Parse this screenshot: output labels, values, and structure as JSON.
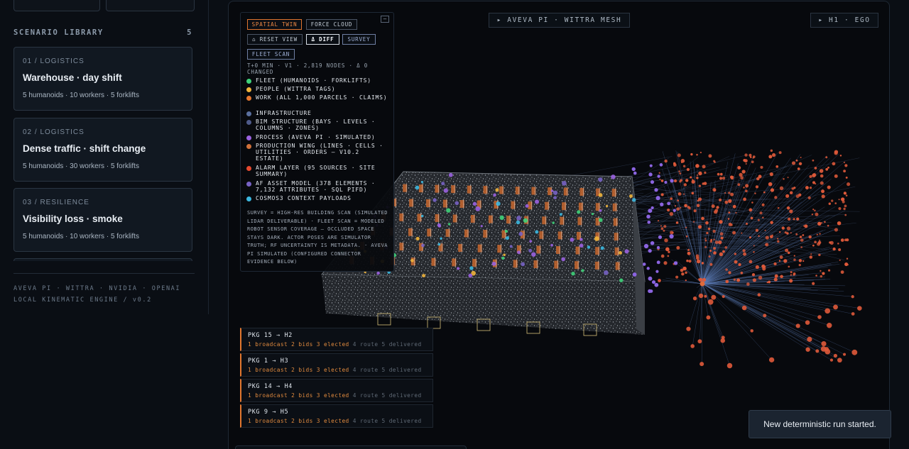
{
  "sidebar": {
    "library_title": "SCENARIO LIBRARY",
    "library_count": "5",
    "scenarios": [
      {
        "category": "01 / LOGISTICS",
        "title": "Warehouse · day shift",
        "meta": "5 humanoids · 10 workers · 5 forklifts"
      },
      {
        "category": "02 / LOGISTICS",
        "title": "Dense traffic · shift change",
        "meta": "5 humanoids · 30 workers · 5 forklifts"
      },
      {
        "category": "03 / RESILIENCE",
        "title": "Visibility loss · smoke",
        "meta": "5 humanoids · 10 workers · 5 forklifts"
      }
    ],
    "footer_line1": "AVEVA PI · WITTRA · NVIDIA · OPENAI",
    "footer_line2": "LOCAL KINEMATIC ENGINE / v0.2"
  },
  "viewport": {
    "center_chip": "▸ AVEVA PI · WITTRA MESH",
    "right_chip": "▸ H1 · EGO"
  },
  "panel": {
    "buttons": {
      "spatial_twin": "SPATIAL TWIN",
      "force_cloud": "FORCE CLOUD",
      "reset_view": "⌂ RESET VIEW",
      "diff": "Δ DIFF",
      "survey": "SURVEY",
      "fleet_scan": "FLEET SCAN",
      "collapse": "–"
    },
    "status": "T+0 MIN · V1 · 2,819 NODES · Δ 0 CHANGED",
    "legend": [
      {
        "label": "FLEET (HUMANOIDS · FORKLIFTS)",
        "color": "#3fd27a"
      },
      {
        "label": "PEOPLE (WITTRA TAGS)",
        "color": "#f0b43c"
      },
      {
        "label": "WORK (ALL 1,000 PARCELS · CLAIMS)",
        "color": "#e6772f"
      },
      {
        "label": "INFRASTRUCTURE",
        "color": "#5a6f9e"
      },
      {
        "label": "BIM STRUCTURE (BAYS · LEVELS · COLUMNS · ZONES)",
        "color": "#4e5a8a"
      },
      {
        "label": "PROCESS (AVEVA PI · SIMULATED)",
        "color": "#9a62e0"
      },
      {
        "label": "PRODUCTION WING (LINES · CELLS · UTILITIES · ORDERS — V10.2 ESTATE)",
        "color": "#d0713a"
      },
      {
        "label": "ALARM LAYER (95 SOURCES · SITE SUMMARY)",
        "color": "#e5492f"
      },
      {
        "label": "AF ASSET MODEL (378 ELEMENTS · 7,132 ATTRIBUTES · SQL PIFD)",
        "color": "#7762c4"
      },
      {
        "label": "COSMOS3 CONTEXT PAYLOADS",
        "color": "#3cb8e0"
      }
    ],
    "footnote": "SURVEY = HIGH-RES BUILDING SCAN (SIMULATED LIDAR DELIVERABLE) · FLEET SCAN = MODELED ROBOT SENSOR COVERAGE — OCCLUDED SPACE STAYS DARK. ACTOR POSES ARE SIMULATOR TRUTH; RF UNCERTAINTY IS METADATA. · AVEVA PI SIMULATED (CONFIGURED CONNECTOR EVIDENCE BELOW)"
  },
  "tasks": [
    {
      "title": "PKG 15 → H2",
      "progress": "1 broadcast 2 bids 3 elected",
      "pending": "4 route 5 delivered"
    },
    {
      "title": "PKG 1 → H3",
      "progress": "1 broadcast 2 bids 3 elected",
      "pending": "4 route 5 delivered"
    },
    {
      "title": "PKG 14 → H4",
      "progress": "1 broadcast 2 bids 3 elected",
      "pending": "4 route 5 delivered"
    },
    {
      "title": "PKG 9 → H5",
      "progress": "1 broadcast 2 bids 3 elected",
      "pending": "4 route 5 delivered"
    }
  ],
  "toast": "New deterministic run started.",
  "colors": {
    "accent": "#e2772f",
    "background": "#0a0e14",
    "node_red": "#e05a3a",
    "edge_blue": "#5a79b3"
  }
}
